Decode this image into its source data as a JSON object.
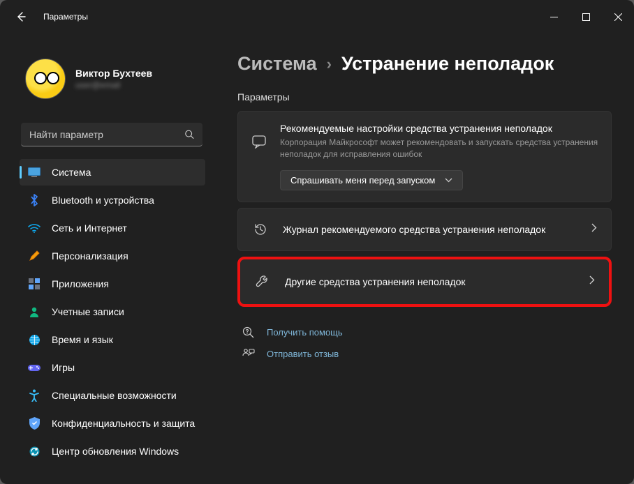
{
  "titlebar": {
    "title": "Параметры"
  },
  "profile": {
    "name": "Виктор Бухтеев",
    "email": "user@email"
  },
  "search": {
    "placeholder": "Найти параметр"
  },
  "nav": [
    {
      "key": "system",
      "label": "Система",
      "active": true
    },
    {
      "key": "bluetooth",
      "label": "Bluetooth и устройства",
      "active": false
    },
    {
      "key": "network",
      "label": "Сеть и Интернет",
      "active": false
    },
    {
      "key": "personalize",
      "label": "Персонализация",
      "active": false
    },
    {
      "key": "apps",
      "label": "Приложения",
      "active": false
    },
    {
      "key": "accounts",
      "label": "Учетные записи",
      "active": false
    },
    {
      "key": "time",
      "label": "Время и язык",
      "active": false
    },
    {
      "key": "gaming",
      "label": "Игры",
      "active": false
    },
    {
      "key": "access",
      "label": "Специальные возможности",
      "active": false
    },
    {
      "key": "privacy",
      "label": "Конфиденциальность и защита",
      "active": false
    },
    {
      "key": "update",
      "label": "Центр обновления Windows",
      "active": false
    }
  ],
  "breadcrumb": {
    "parent": "Система",
    "sep": "›",
    "current": "Устранение неполадок"
  },
  "section_label": "Параметры",
  "settings_card": {
    "title": "Рекомендуемые настройки средства устранения неполадок",
    "subtitle": "Корпорация Майкрософт может рекомендовать и запускать средства устранения неполадок для исправления ошибок",
    "dropdown": "Спрашивать меня перед запуском"
  },
  "links": {
    "history": "Журнал рекомендуемого средства устранения неполадок",
    "other": "Другие средства устранения неполадок"
  },
  "footer": {
    "help": "Получить помощь",
    "feedback": "Отправить отзыв"
  }
}
